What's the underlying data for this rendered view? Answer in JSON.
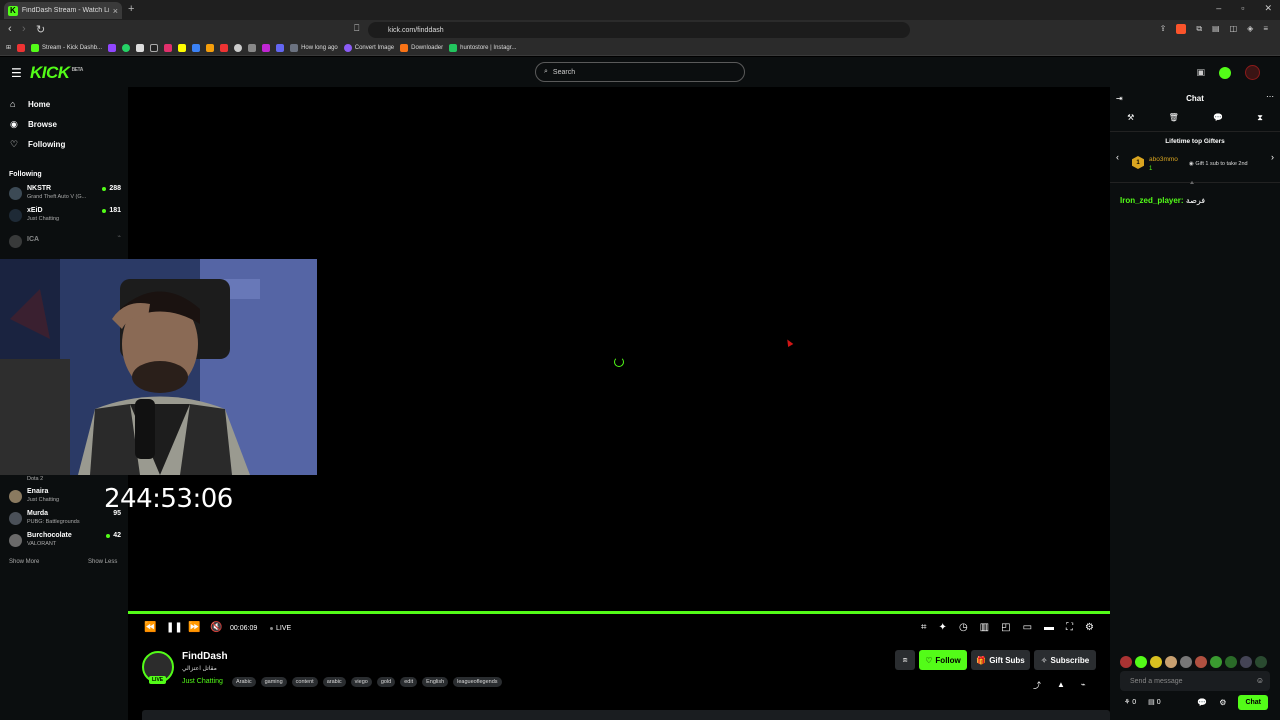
{
  "browser": {
    "tab_title": "FindDash Stream - Watch Live o",
    "tab_close": "×",
    "new_tab": "+",
    "url": "kick.com/finddash",
    "bookmarks": [
      "Stream - Kick Dashb...",
      "How long ago",
      "Convert Image",
      "Downloader",
      "huntostore | Instagr..."
    ]
  },
  "header": {
    "logo": "KICK",
    "logo_sup": "BETA",
    "search_placeholder": "Search"
  },
  "sidebar": {
    "nav": [
      {
        "label": "Home",
        "icon": "home-icon"
      },
      {
        "label": "Browse",
        "icon": "compass-icon"
      },
      {
        "label": "Following",
        "icon": "heart-icon"
      }
    ],
    "following_title": "Following",
    "channels_top": [
      {
        "name": "NKSTR",
        "game": "Grand Theft Auto V (G...",
        "viewers": "288"
      },
      {
        "name": "xEiD",
        "game": "Just Chatting",
        "viewers": "181"
      },
      {
        "name": "ICA",
        "game": "",
        "viewers": ""
      }
    ],
    "channels_bottom": [
      {
        "name": "",
        "game": "Dota 2",
        "viewers": ""
      },
      {
        "name": "Enaira",
        "game": "Just Chatting",
        "viewers": ""
      },
      {
        "name": "Murda",
        "game": "PUBG: Battlegrounds",
        "viewers": "95"
      },
      {
        "name": "Burchocolate",
        "game": "VALORANT",
        "viewers": "42"
      }
    ],
    "show_more": "Show More",
    "show_less": "Show Less"
  },
  "player": {
    "overlay_timer": "244:53:06",
    "time": "00:06:09",
    "live_label": "LIVE",
    "progress": 1.0
  },
  "stream": {
    "name": "FindDash",
    "title": "مقاتل اعتزالي",
    "live_badge": "LIVE",
    "category": "Just Chatting",
    "tags": [
      "Arabic",
      "gaming",
      "content",
      "arabic",
      "viego",
      "gold",
      "edit",
      "English",
      "leagueoflegends"
    ],
    "follow_label": "Follow",
    "gift_label": "Gift Subs",
    "subscribe_label": "Subscribe"
  },
  "chat": {
    "title": "Chat",
    "gifters_title": "Lifetime top Gifters",
    "top_gifter_rank": "1",
    "top_gifter_name": "abo3mmo",
    "top_gifter_count": "1",
    "gifter_hint": "Gift 1 sub to take 2nd",
    "messages": [
      {
        "user": "Iron_zed_player:",
        "text": "فرصة"
      }
    ],
    "input_placeholder": "Send a message",
    "points_count": "0",
    "gifts_count": "0",
    "send_label": "Chat"
  },
  "colors": {
    "accent": "#53fc18",
    "background": "#000000",
    "panel": "#0b0e0f"
  }
}
